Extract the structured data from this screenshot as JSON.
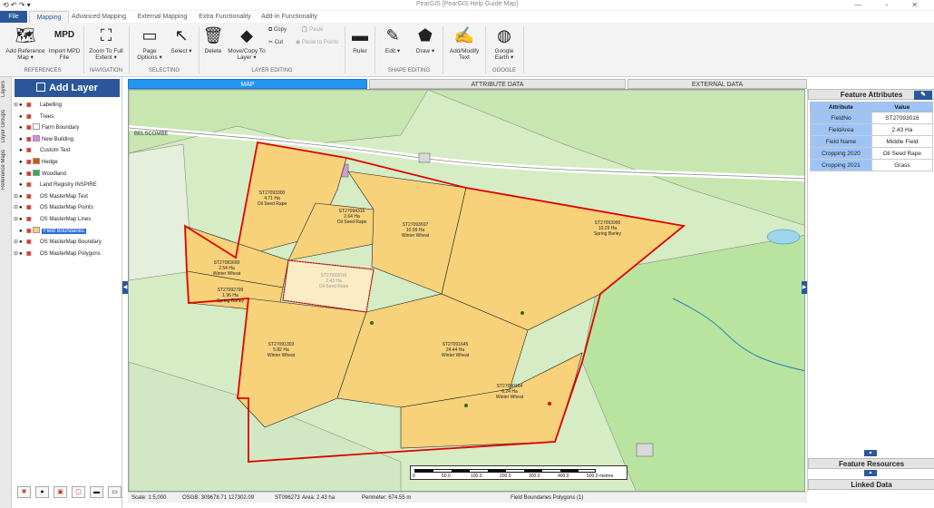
{
  "window": {
    "title": "PearGIS [PearGIS Help Guide Map]",
    "quick_access": "⟲ ↶ ↷ ▾",
    "controls": "—  ▫  ✕"
  },
  "tabs": [
    {
      "label": "File"
    },
    {
      "label": "Mapping"
    },
    {
      "label": "Advanced Mapping"
    },
    {
      "label": "External Mapping"
    },
    {
      "label": "Extra Functionality"
    },
    {
      "label": "Add-In Functionality"
    }
  ],
  "ribbon": {
    "add_reference_map": "Add Reference Map ▾",
    "import_mpd": "Import MPD File",
    "mpd_icon_text": "MPD",
    "zoom_full": "Zoom To Full Extent ▾",
    "page_options": "Page Options ▾",
    "select": "Select ▾",
    "delete": "Delete",
    "move_copy": "Move/Copy To Layer ▾",
    "copy": "Copy",
    "cut": "Cut",
    "paste": "Paste",
    "paste_to_points": "Paste to Points",
    "ruler": "Ruler",
    "edit": "Edit ▾",
    "draw": "Draw ▾",
    "add_modify_text": "Add/Modify Text",
    "google_earth": "Google Earth ▾",
    "groups": {
      "references": "REFERENCES",
      "navigation": "NAVIGATION",
      "selecting": "SELECTING",
      "layer_editing": "LAYER EDITING",
      "shape_editing": "SHAPE EDITING",
      "google": "GOOGLE"
    }
  },
  "side_tabs": [
    "Layers",
    "Layer Groups",
    "Reference Maps"
  ],
  "layers_panel": {
    "add_layer": "Add Layer",
    "layers": [
      {
        "name": "Labelling",
        "swatch": "",
        "expand": "⊞"
      },
      {
        "name": "Trees",
        "swatch": "",
        "expand": ""
      },
      {
        "name": "Farm Boundary",
        "swatch": "#ffffff",
        "expand": ""
      },
      {
        "name": "New Building",
        "swatch": "#d98ee6",
        "expand": ""
      },
      {
        "name": "Custom Text",
        "swatch": "",
        "expand": ""
      },
      {
        "name": "Hedge",
        "swatch": "#d35400",
        "expand": ""
      },
      {
        "name": "Woodland",
        "swatch": "#27ae60",
        "expand": ""
      },
      {
        "name": "Land Registry INSPIRE",
        "swatch": "",
        "expand": ""
      },
      {
        "name": "OS MasterMap Text",
        "swatch": "",
        "expand": "⊞"
      },
      {
        "name": "OS MasterMap Points",
        "swatch": "",
        "expand": "⊞"
      },
      {
        "name": "OS MasterMap Lines",
        "swatch": "",
        "expand": "⊞"
      },
      {
        "name": "Field Boundaries",
        "swatch": "#f7d27a",
        "expand": "",
        "selected": true
      },
      {
        "name": "OS MasterMap Boundary",
        "swatch": "",
        "expand": "⊞"
      },
      {
        "name": "OS MasterMap Polygons",
        "swatch": "",
        "expand": "⊞"
      }
    ]
  },
  "map_tabs": [
    {
      "label": "MAP"
    },
    {
      "label": "ATTRIBUTE DATA"
    },
    {
      "label": "EXTERNAL DATA"
    }
  ],
  "map": {
    "place_label": "BELSCOMBE",
    "fields": [
      {
        "id": "ST27093300",
        "area": "4.71 Ha",
        "crop": "Oil Seed Rape"
      },
      {
        "id": "ST27094316",
        "area": "2.64 Ha",
        "crop": "Oil Seed Rape"
      },
      {
        "id": "ST27093697",
        "area": "10.99 Ha",
        "crop": "Winter Wheat"
      },
      {
        "id": "ST27093990",
        "area": "10.29 Ha",
        "crop": "Spring Barley"
      },
      {
        "id": "ST27083699",
        "area": "2.54 Ha",
        "crop": "Winter Wheat"
      },
      {
        "id": "ST27093016",
        "area": "2.43 Ha",
        "crop": "Oil Seed Rape"
      },
      {
        "id": "ST27092799",
        "area": "1.96 Ha",
        "crop": "Spring Barley"
      },
      {
        "id": "ST27091303",
        "area": "5.82 Ha",
        "crop": "Winter Wheat"
      },
      {
        "id": "ST27091645",
        "area": "24.44 Ha",
        "crop": "Winter Wheat"
      },
      {
        "id": "ST27090164",
        "area": "6.24 Ha",
        "crop": "Winter Wheat"
      }
    ],
    "scale_ticks": [
      "0",
      "50.0",
      "100.0",
      "200.0",
      "300.0",
      "400.0",
      "500.0"
    ],
    "scale_unit": "metres"
  },
  "status": {
    "scale": "Scale: 1:5,000",
    "osgb": "OSGB: 309678.71 127302.09",
    "tile": "ST096273",
    "area": "Area: 2.43 ha",
    "perimeter": "Perimeter: 674.55 m",
    "layer_info": "Field Boundaries Polygons (1)"
  },
  "feature_attributes": {
    "title": "Feature Attributes",
    "edit_icon": "✎",
    "col_attribute": "Attribute",
    "col_value": "Value",
    "rows": [
      {
        "k": "FieldNo",
        "v": "ST27093016"
      },
      {
        "k": "FieldArea",
        "v": "2.43 Ha"
      },
      {
        "k": "Field Name",
        "v": "Middle Field"
      },
      {
        "k": "Cropping 2020",
        "v": "Oil Seed Rape"
      },
      {
        "k": "Cropping 2021",
        "v": "Grass"
      }
    ]
  },
  "feature_resources": "Feature Resources",
  "linked_data": "Linked Data"
}
